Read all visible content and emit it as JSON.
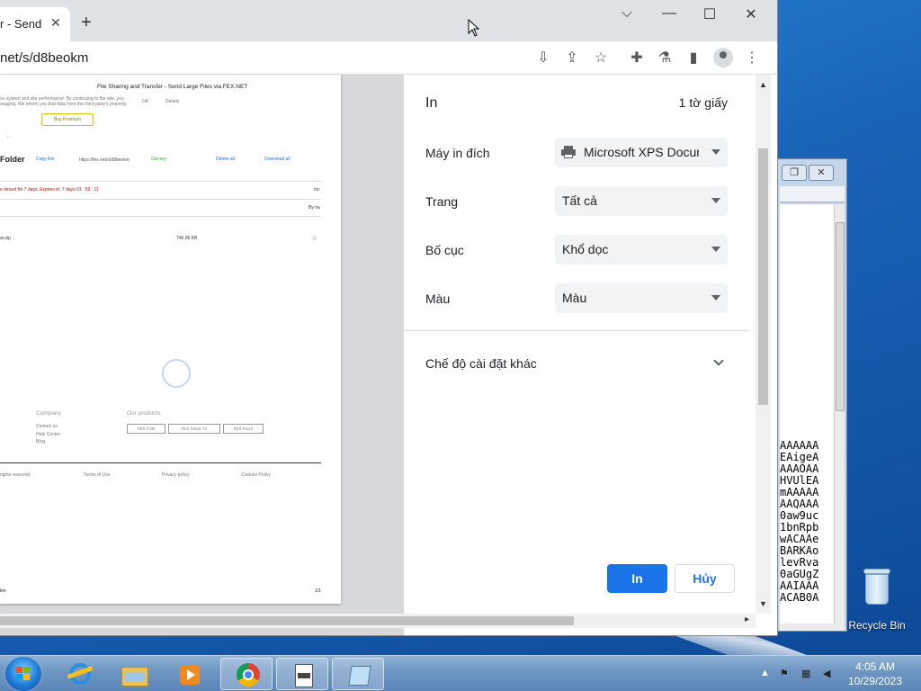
{
  "browser": {
    "tab_title": "r - Send",
    "tab_close": "✕",
    "new_tab": "+",
    "url": "net/s/d8beokm",
    "window_controls": {
      "collapse": "⌵",
      "minimize": "—",
      "maximize": "☐",
      "close": "✕"
    }
  },
  "preview": {
    "page_title": "File Sharing and Transfer - Send Large Files via FEX.NET",
    "promo_line1": "ce system and site performance. By continuing to the site, you",
    "promo_line2": "ssaging. We inform you that data from this third party's property.",
    "ok_label": "OK",
    "details_label": "Details",
    "buy_premium": "Buy Premium",
    "folder_label": "Folder",
    "copy_link": "Copy link",
    "folder_url": "https://fex.net/s/d8beokm",
    "get_key": "Get key",
    "delete_all": "Delete all",
    "download_all": "Download all",
    "storage_notice": "e stored for 7 days. Expires in:  7 days  01 : 59 : 11",
    "inc_label": "Inc",
    "by_label": "By na",
    "file_name": "ar.zip",
    "file_size": "746.06 KB",
    "footer_company": "Company",
    "footer_products": "Our products",
    "contact_us": "Contact us",
    "help_center": "Help Center",
    "blog": "Blog",
    "product_fex_for": "FEX FOR",
    "product_fex_tv": "FEX Smart TV",
    "product_fex_plus": "FEX PLUS",
    "rights": "rights reserved",
    "terms": "Terms of Use",
    "privacy": "Privacy policy",
    "cookies": "Cookies Policy",
    "page_footer_left": "km",
    "page_footer_right": "1/1"
  },
  "print_dialog": {
    "title": "In",
    "sheet_count": "1 tờ giấy",
    "destination_label": "Máy in đích",
    "destination_value": "Microsoft XPS Document Writer",
    "pages_label": "Trang",
    "pages_value": "Tất cả",
    "layout_label": "Bố cục",
    "layout_value": "Khổ dọc",
    "color_label": "Màu",
    "color_value": "Màu",
    "more_settings": "Chế độ cài đặt khác",
    "print_button": "In",
    "cancel_button": "Hủy"
  },
  "background_window": {
    "text_lines": [
      "AAAAAA",
      "EAigeA",
      "AAAOAA",
      "HVUlEA",
      "mAAAAA",
      "AAQAAA",
      "0aw9uc",
      "1bnRpb",
      "wACAAe",
      "BARKAo",
      "levRva",
      "0aGUgZ",
      "AAIAAA",
      "ACAB0A"
    ]
  },
  "desktop": {
    "recycle_bin": "Recycle Bin"
  },
  "taskbar": {
    "time": "4:05 AM",
    "date": "10/29/2023"
  },
  "colors": {
    "accent": "#1a73e8",
    "select_bg": "#f1f3f4",
    "taskbar": "#6f97c3"
  }
}
